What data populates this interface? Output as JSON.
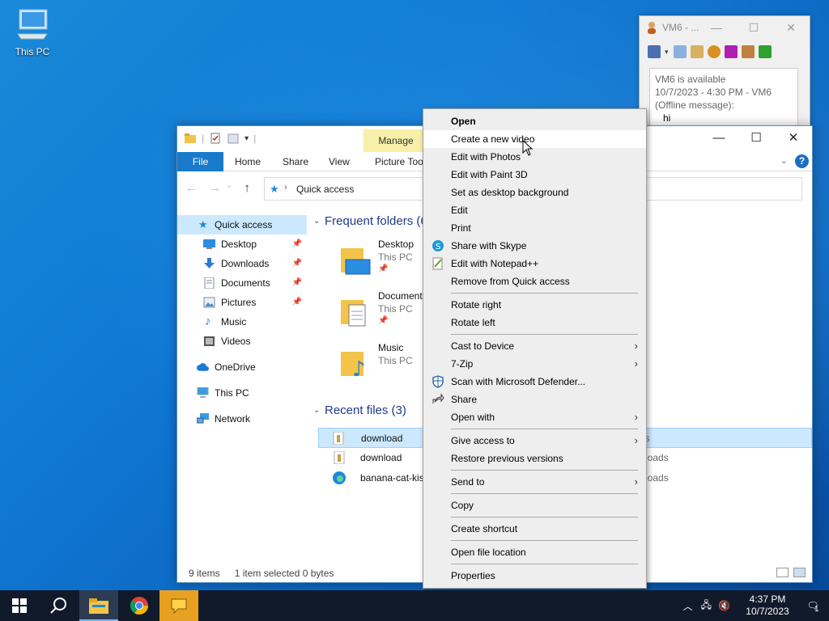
{
  "desktop": {
    "icon_label": "This PC"
  },
  "chat": {
    "title": "VM6 - ...",
    "messages": [
      "VM6 is available",
      "10/7/2023 - 4:30 PM - VM6",
      "(Offline message):",
      "hi"
    ]
  },
  "explorer": {
    "manage_tab": "Manage",
    "ribbon_tabs": [
      "File",
      "Home",
      "Share",
      "View",
      "Picture Tool"
    ],
    "address": "Quick access",
    "nav": [
      {
        "label": "Quick access",
        "icon": "star-icon"
      },
      {
        "label": "Desktop",
        "icon": "desktop-icon"
      },
      {
        "label": "Downloads",
        "icon": "download-icon"
      },
      {
        "label": "Documents",
        "icon": "documents-icon"
      },
      {
        "label": "Pictures",
        "icon": "pictures-icon"
      },
      {
        "label": "Music",
        "icon": "music-icon"
      },
      {
        "label": "Videos",
        "icon": "videos-icon"
      },
      {
        "label": "OneDrive",
        "icon": "cloud-icon"
      },
      {
        "label": "This PC",
        "icon": "computer-icon"
      },
      {
        "label": "Network",
        "icon": "network-icon"
      }
    ],
    "frequent_header": "Frequent folders (6",
    "frequent": [
      {
        "name": "Desktop",
        "location": "This PC"
      },
      {
        "name": "Document",
        "location": "This PC"
      },
      {
        "name": "Music",
        "location": "This PC"
      }
    ],
    "recent_header": "Recent files (3)",
    "recent": [
      {
        "name": "download",
        "path": "res"
      },
      {
        "name": "download",
        "path": "loads"
      },
      {
        "name": "banana-cat-kis",
        "path": "loads"
      }
    ],
    "status": {
      "items": "9 items",
      "selected": "1 item selected  0 bytes"
    }
  },
  "context_menu": {
    "items": [
      {
        "label": "Open",
        "bold": true
      },
      {
        "label": "Create a new video",
        "hover": true
      },
      {
        "label": "Edit with Photos"
      },
      {
        "label": "Edit with Paint 3D"
      },
      {
        "label": "Set as desktop background"
      },
      {
        "label": "Edit"
      },
      {
        "label": "Print"
      },
      {
        "label": "Share with Skype",
        "icon": "skype-icon"
      },
      {
        "label": "Edit with Notepad++",
        "icon": "notepadpp-icon"
      },
      {
        "label": "Remove from Quick access"
      },
      {
        "sep": true
      },
      {
        "label": "Rotate right"
      },
      {
        "label": "Rotate left"
      },
      {
        "sep": true
      },
      {
        "label": "Cast to Device",
        "submenu": true
      },
      {
        "label": "7-Zip",
        "submenu": true
      },
      {
        "label": "Scan with Microsoft Defender...",
        "icon": "defender-icon"
      },
      {
        "label": "Share",
        "icon": "share-icon"
      },
      {
        "label": "Open with",
        "submenu": true
      },
      {
        "sep": true
      },
      {
        "label": "Give access to",
        "submenu": true
      },
      {
        "label": "Restore previous versions"
      },
      {
        "sep": true
      },
      {
        "label": "Send to",
        "submenu": true
      },
      {
        "sep": true
      },
      {
        "label": "Copy"
      },
      {
        "sep": true
      },
      {
        "label": "Create shortcut"
      },
      {
        "sep": true
      },
      {
        "label": "Open file location"
      },
      {
        "sep": true
      },
      {
        "label": "Properties"
      }
    ]
  },
  "taskbar": {
    "time": "4:37 PM",
    "date": "10/7/2023",
    "notifications": "1"
  },
  "colors": {
    "accent": "#1979ca",
    "selection": "#cce8ff",
    "menu_bg": "#eeeeee"
  }
}
